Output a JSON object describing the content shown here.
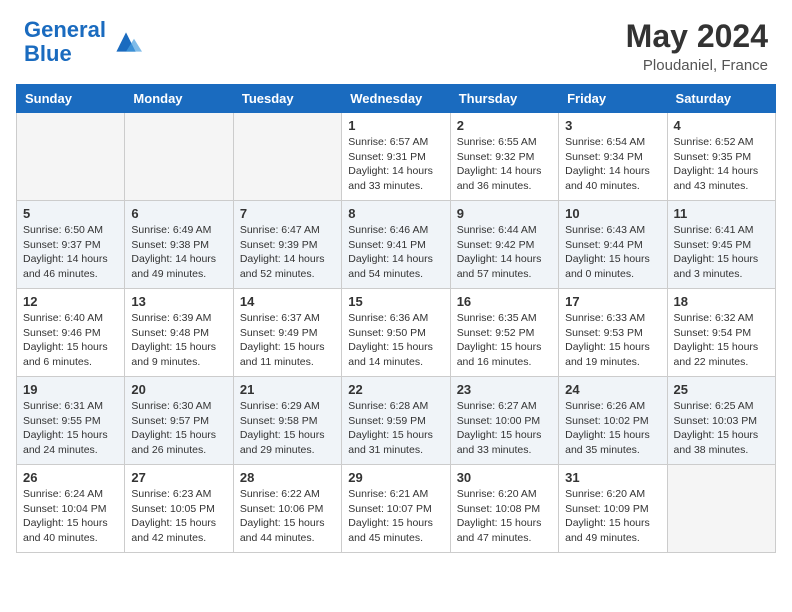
{
  "header": {
    "logo_general": "General",
    "logo_blue": "Blue",
    "month_title": "May 2024",
    "location": "Ploudaniel, France"
  },
  "days_of_week": [
    "Sunday",
    "Monday",
    "Tuesday",
    "Wednesday",
    "Thursday",
    "Friday",
    "Saturday"
  ],
  "weeks": [
    [
      {
        "date": "",
        "info": ""
      },
      {
        "date": "",
        "info": ""
      },
      {
        "date": "",
        "info": ""
      },
      {
        "date": "1",
        "info": "Sunrise: 6:57 AM\nSunset: 9:31 PM\nDaylight: 14 hours\nand 33 minutes."
      },
      {
        "date": "2",
        "info": "Sunrise: 6:55 AM\nSunset: 9:32 PM\nDaylight: 14 hours\nand 36 minutes."
      },
      {
        "date": "3",
        "info": "Sunrise: 6:54 AM\nSunset: 9:34 PM\nDaylight: 14 hours\nand 40 minutes."
      },
      {
        "date": "4",
        "info": "Sunrise: 6:52 AM\nSunset: 9:35 PM\nDaylight: 14 hours\nand 43 minutes."
      }
    ],
    [
      {
        "date": "5",
        "info": "Sunrise: 6:50 AM\nSunset: 9:37 PM\nDaylight: 14 hours\nand 46 minutes."
      },
      {
        "date": "6",
        "info": "Sunrise: 6:49 AM\nSunset: 9:38 PM\nDaylight: 14 hours\nand 49 minutes."
      },
      {
        "date": "7",
        "info": "Sunrise: 6:47 AM\nSunset: 9:39 PM\nDaylight: 14 hours\nand 52 minutes."
      },
      {
        "date": "8",
        "info": "Sunrise: 6:46 AM\nSunset: 9:41 PM\nDaylight: 14 hours\nand 54 minutes."
      },
      {
        "date": "9",
        "info": "Sunrise: 6:44 AM\nSunset: 9:42 PM\nDaylight: 14 hours\nand 57 minutes."
      },
      {
        "date": "10",
        "info": "Sunrise: 6:43 AM\nSunset: 9:44 PM\nDaylight: 15 hours\nand 0 minutes."
      },
      {
        "date": "11",
        "info": "Sunrise: 6:41 AM\nSunset: 9:45 PM\nDaylight: 15 hours\nand 3 minutes."
      }
    ],
    [
      {
        "date": "12",
        "info": "Sunrise: 6:40 AM\nSunset: 9:46 PM\nDaylight: 15 hours\nand 6 minutes."
      },
      {
        "date": "13",
        "info": "Sunrise: 6:39 AM\nSunset: 9:48 PM\nDaylight: 15 hours\nand 9 minutes."
      },
      {
        "date": "14",
        "info": "Sunrise: 6:37 AM\nSunset: 9:49 PM\nDaylight: 15 hours\nand 11 minutes."
      },
      {
        "date": "15",
        "info": "Sunrise: 6:36 AM\nSunset: 9:50 PM\nDaylight: 15 hours\nand 14 minutes."
      },
      {
        "date": "16",
        "info": "Sunrise: 6:35 AM\nSunset: 9:52 PM\nDaylight: 15 hours\nand 16 minutes."
      },
      {
        "date": "17",
        "info": "Sunrise: 6:33 AM\nSunset: 9:53 PM\nDaylight: 15 hours\nand 19 minutes."
      },
      {
        "date": "18",
        "info": "Sunrise: 6:32 AM\nSunset: 9:54 PM\nDaylight: 15 hours\nand 22 minutes."
      }
    ],
    [
      {
        "date": "19",
        "info": "Sunrise: 6:31 AM\nSunset: 9:55 PM\nDaylight: 15 hours\nand 24 minutes."
      },
      {
        "date": "20",
        "info": "Sunrise: 6:30 AM\nSunset: 9:57 PM\nDaylight: 15 hours\nand 26 minutes."
      },
      {
        "date": "21",
        "info": "Sunrise: 6:29 AM\nSunset: 9:58 PM\nDaylight: 15 hours\nand 29 minutes."
      },
      {
        "date": "22",
        "info": "Sunrise: 6:28 AM\nSunset: 9:59 PM\nDaylight: 15 hours\nand 31 minutes."
      },
      {
        "date": "23",
        "info": "Sunrise: 6:27 AM\nSunset: 10:00 PM\nDaylight: 15 hours\nand 33 minutes."
      },
      {
        "date": "24",
        "info": "Sunrise: 6:26 AM\nSunset: 10:02 PM\nDaylight: 15 hours\nand 35 minutes."
      },
      {
        "date": "25",
        "info": "Sunrise: 6:25 AM\nSunset: 10:03 PM\nDaylight: 15 hours\nand 38 minutes."
      }
    ],
    [
      {
        "date": "26",
        "info": "Sunrise: 6:24 AM\nSunset: 10:04 PM\nDaylight: 15 hours\nand 40 minutes."
      },
      {
        "date": "27",
        "info": "Sunrise: 6:23 AM\nSunset: 10:05 PM\nDaylight: 15 hours\nand 42 minutes."
      },
      {
        "date": "28",
        "info": "Sunrise: 6:22 AM\nSunset: 10:06 PM\nDaylight: 15 hours\nand 44 minutes."
      },
      {
        "date": "29",
        "info": "Sunrise: 6:21 AM\nSunset: 10:07 PM\nDaylight: 15 hours\nand 45 minutes."
      },
      {
        "date": "30",
        "info": "Sunrise: 6:20 AM\nSunset: 10:08 PM\nDaylight: 15 hours\nand 47 minutes."
      },
      {
        "date": "31",
        "info": "Sunrise: 6:20 AM\nSunset: 10:09 PM\nDaylight: 15 hours\nand 49 minutes."
      },
      {
        "date": "",
        "info": ""
      }
    ]
  ]
}
